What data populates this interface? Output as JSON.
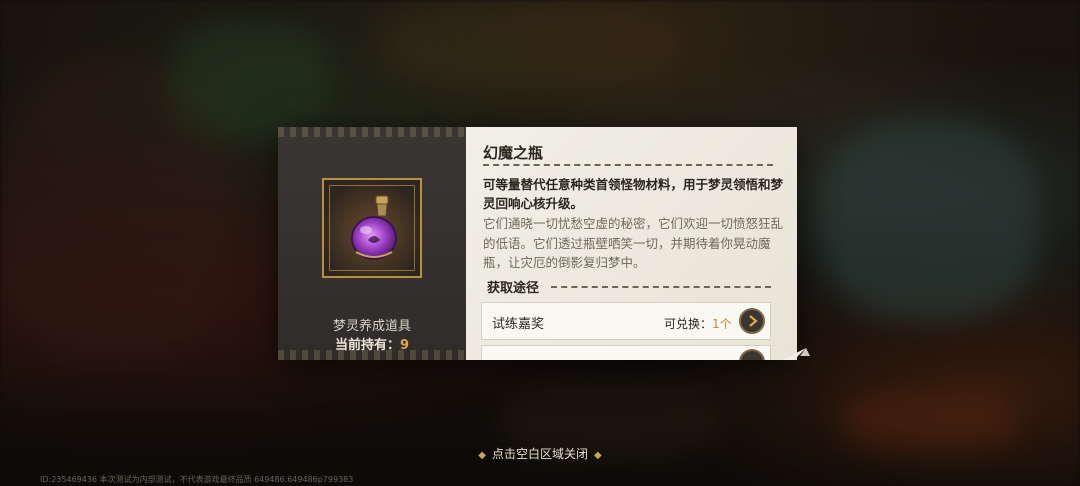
{
  "item": {
    "name": "幻魔之瓶",
    "type": "梦灵养成道具",
    "held_label": "当前持有：",
    "held_count": "9",
    "description": "可等量替代任意种类首领怪物材料，用于梦灵领悟和梦灵回响心核升级。",
    "flavor": "它们通晓一切忧愁空虚的秘密，它们欢迎一切愤怒狂乱的低语。它们透过瓶壁哂笑一切，并期待着你晃动魔瓶，让灾厄的倒影复归梦中。",
    "icon": "purple-potion-bottle-icon"
  },
  "sources": {
    "title": "获取途径",
    "items": [
      {
        "name": "试练嘉奖",
        "exchange_label": "可兑换：",
        "exchange_qty": "1个"
      }
    ]
  },
  "close_hint": "点击空白区域关闭",
  "footer_id": "ID:235469436 本次测试为内部测试，不代表游戏最终品质 649486.649486p799383",
  "colors": {
    "accent": "#e1a84a",
    "frame": "#b9913e"
  }
}
